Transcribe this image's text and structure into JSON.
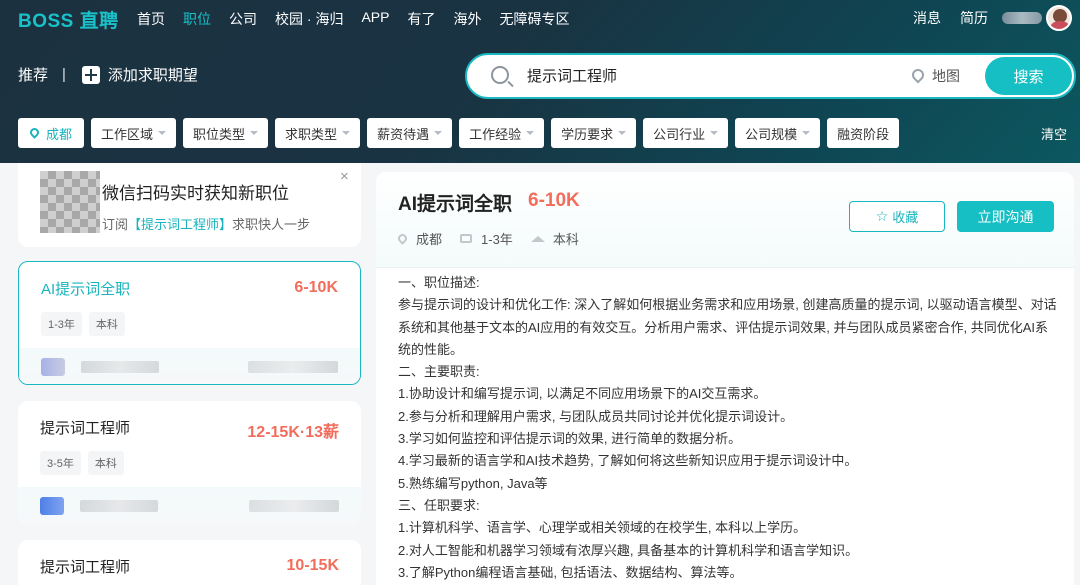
{
  "nav": {
    "logo": "BOSS 直聘",
    "items": [
      "首页",
      "职位",
      "公司",
      "校园 · 海归",
      "APP",
      "有了",
      "海外",
      "无障碍专区"
    ],
    "active_index": 1,
    "right": {
      "messages": "消息",
      "resume": "简历"
    }
  },
  "header": {
    "recommend": "推荐",
    "add_expectation": "添加求职期望"
  },
  "search": {
    "value": "提示词工程师",
    "map_label": "地图",
    "button": "搜索"
  },
  "filters": {
    "city": "成都",
    "items": [
      "工作区域",
      "职位类型",
      "求职类型",
      "薪资待遇",
      "工作经验",
      "学历要求",
      "公司行业",
      "公司规模",
      "融资阶段"
    ],
    "clear": "清空"
  },
  "subscribe": {
    "title": "微信扫码实时获知新职位",
    "desc_prefix": "订阅",
    "keyword": "【提示词工程师】",
    "desc_suffix": "求职快人一步",
    "close": "×"
  },
  "jobs": [
    {
      "name": "AI提示词全职",
      "salary": "6-10K",
      "tags": [
        "1-3年",
        "本科"
      ]
    },
    {
      "name": "提示词工程师",
      "salary": "12-15K·13薪",
      "tags": [
        "3-5年",
        "本科"
      ]
    },
    {
      "name": "提示词工程师",
      "salary": "10-15K",
      "tags": []
    }
  ],
  "detail": {
    "title": "AI提示词全职",
    "salary": "6-10K",
    "city": "成都",
    "experience": "1-3年",
    "education": "本科",
    "fav_label": "收藏",
    "chat_label": "立即沟通",
    "description": [
      "一、职位描述:",
      "参与提示词的设计和优化工作: 深入了解如何根据业务需求和应用场景, 创建高质量的提示词, 以驱动语言模型、对话系统和其他基于文本的AI应用的有效交互。分析用户需求、评估提示词效果, 并与团队成员紧密合作, 共同优化AI系统的性能。",
      "二、主要职责:",
      "1.协助设计和编写提示词, 以满足不同应用场景下的AI交互需求。",
      "2.参与分析和理解用户需求, 与团队成员共同讨论并优化提示词设计。",
      "3.学习如何监控和评估提示词的效果, 进行简单的数据分析。",
      "4.学习最新的语言学和AI技术趋势, 了解如何将这些新知识应用于提示词设计中。",
      "5.熟练编写python, Java等",
      "三、任职要求:",
      "1.计算机科学、语言学、心理学或相关领域的在校学生, 本科以上学历。",
      "2.对人工智能和机器学习领域有浓厚兴趣, 具备基本的计算机科学和语言学知识。",
      "3.了解Python编程语言基础, 包括语法、数据结构、算法等。"
    ]
  }
}
